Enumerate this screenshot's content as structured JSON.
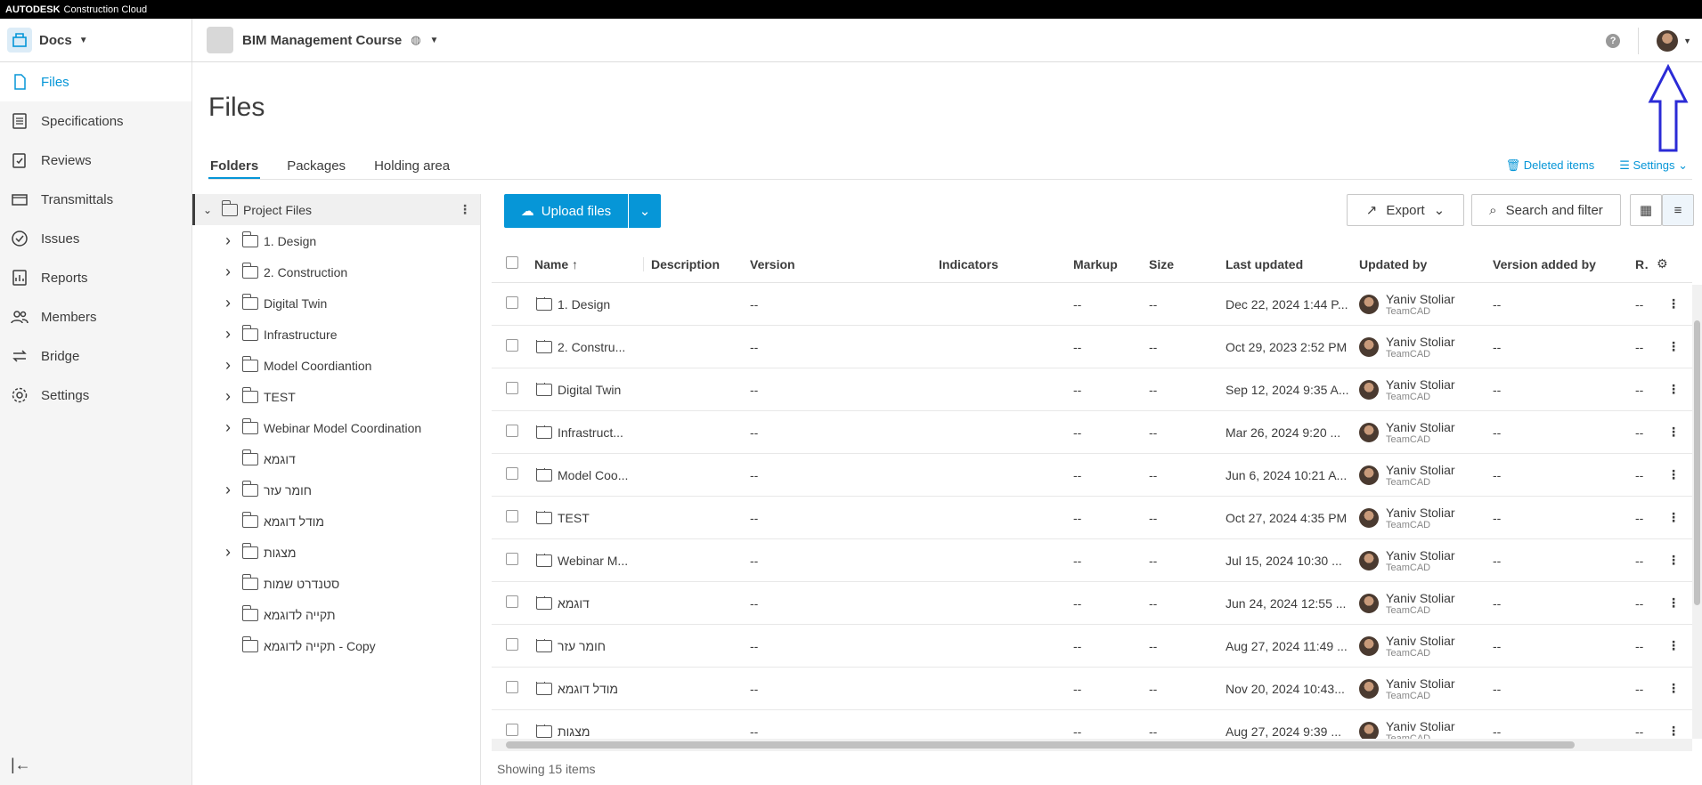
{
  "topbar": {
    "brand": "AUTODESK",
    "product": "Construction Cloud"
  },
  "header": {
    "module": "Docs",
    "project": "BIM Management Course"
  },
  "sidebar": {
    "items": [
      {
        "label": "Files",
        "icon": "file-icon"
      },
      {
        "label": "Specifications",
        "icon": "specifications-icon"
      },
      {
        "label": "Reviews",
        "icon": "reviews-icon"
      },
      {
        "label": "Transmittals",
        "icon": "transmittals-icon"
      },
      {
        "label": "Issues",
        "icon": "issues-icon"
      },
      {
        "label": "Reports",
        "icon": "reports-icon"
      },
      {
        "label": "Members",
        "icon": "members-icon"
      },
      {
        "label": "Bridge",
        "icon": "bridge-icon"
      },
      {
        "label": "Settings",
        "icon": "gear-icon"
      }
    ]
  },
  "page": {
    "title": "Files"
  },
  "tabs": [
    "Folders",
    "Packages",
    "Holding area"
  ],
  "tab_actions": {
    "deleted": "Deleted items",
    "settings": "Settings"
  },
  "tree": {
    "root": "Project Files",
    "folders": [
      {
        "name": "1. Design",
        "expandable": true
      },
      {
        "name": "2. Construction",
        "expandable": true
      },
      {
        "name": "Digital Twin",
        "expandable": true
      },
      {
        "name": "Infrastructure",
        "expandable": true
      },
      {
        "name": "Model Coordiantion",
        "expandable": true
      },
      {
        "name": "TEST",
        "expandable": true
      },
      {
        "name": "Webinar Model Coordination",
        "expandable": true
      },
      {
        "name": "דוגמא",
        "expandable": false
      },
      {
        "name": "חומר עזר",
        "expandable": true
      },
      {
        "name": "מודל דוגמא",
        "expandable": false
      },
      {
        "name": "מצגות",
        "expandable": true
      },
      {
        "name": "סטנדרט שמות",
        "expandable": false
      },
      {
        "name": "תקייה לדוגמא",
        "expandable": false
      },
      {
        "name": "תקייה לדוגמא - Copy",
        "expandable": false
      }
    ]
  },
  "toolbar": {
    "upload": "Upload files",
    "export": "Export",
    "search": "Search and filter"
  },
  "table": {
    "columns": [
      "Name",
      "Description",
      "Version",
      "Indicators",
      "Markup",
      "Size",
      "Last updated",
      "Updated by",
      "Version added by",
      "Re"
    ],
    "rows": [
      {
        "name": "1. Design",
        "version": "--",
        "markup": "--",
        "size": "--",
        "updated": "Dec 22, 2024 1:44 P...",
        "by": "Yaniv Stoliar",
        "company": "TeamCAD",
        "added": "--",
        "re": "--"
      },
      {
        "name": "2. Constru...",
        "version": "--",
        "markup": "--",
        "size": "--",
        "updated": "Oct 29, 2023 2:52 PM",
        "by": "Yaniv Stoliar",
        "company": "TeamCAD",
        "added": "--",
        "re": "--"
      },
      {
        "name": "Digital Twin",
        "version": "--",
        "markup": "--",
        "size": "--",
        "updated": "Sep 12, 2024 9:35 A...",
        "by": "Yaniv Stoliar",
        "company": "TeamCAD",
        "added": "--",
        "re": "--"
      },
      {
        "name": "Infrastruct...",
        "version": "--",
        "markup": "--",
        "size": "--",
        "updated": "Mar 26, 2024 9:20 ...",
        "by": "Yaniv Stoliar",
        "company": "TeamCAD",
        "added": "--",
        "re": "--"
      },
      {
        "name": "Model Coo...",
        "version": "--",
        "markup": "--",
        "size": "--",
        "updated": "Jun 6, 2024 10:21 A...",
        "by": "Yaniv Stoliar",
        "company": "TeamCAD",
        "added": "--",
        "re": "--"
      },
      {
        "name": "TEST",
        "version": "--",
        "markup": "--",
        "size": "--",
        "updated": "Oct 27, 2024 4:35 PM",
        "by": "Yaniv Stoliar",
        "company": "TeamCAD",
        "added": "--",
        "re": "--"
      },
      {
        "name": "Webinar M...",
        "version": "--",
        "markup": "--",
        "size": "--",
        "updated": "Jul 15, 2024 10:30 ...",
        "by": "Yaniv Stoliar",
        "company": "TeamCAD",
        "added": "--",
        "re": "--"
      },
      {
        "name": "דוגמא",
        "version": "--",
        "markup": "--",
        "size": "--",
        "updated": "Jun 24, 2024 12:55 ...",
        "by": "Yaniv Stoliar",
        "company": "TeamCAD",
        "added": "--",
        "re": "--"
      },
      {
        "name": "חומר עזר",
        "version": "--",
        "markup": "--",
        "size": "--",
        "updated": "Aug 27, 2024 11:49 ...",
        "by": "Yaniv Stoliar",
        "company": "TeamCAD",
        "added": "--",
        "re": "--"
      },
      {
        "name": "מודל דוגמא",
        "version": "--",
        "markup": "--",
        "size": "--",
        "updated": "Nov 20, 2024 10:43...",
        "by": "Yaniv Stoliar",
        "company": "TeamCAD",
        "added": "--",
        "re": "--"
      },
      {
        "name": "מצגות",
        "version": "--",
        "markup": "--",
        "size": "--",
        "updated": "Aug 27, 2024 9:39 ...",
        "by": "Yaniv Stoliar",
        "company": "TeamCAD",
        "added": "--",
        "re": "--"
      }
    ]
  },
  "footer": {
    "count": "Showing 15 items"
  },
  "colors": {
    "accent": "#0696d7",
    "annotation": "#2b2bd6"
  }
}
